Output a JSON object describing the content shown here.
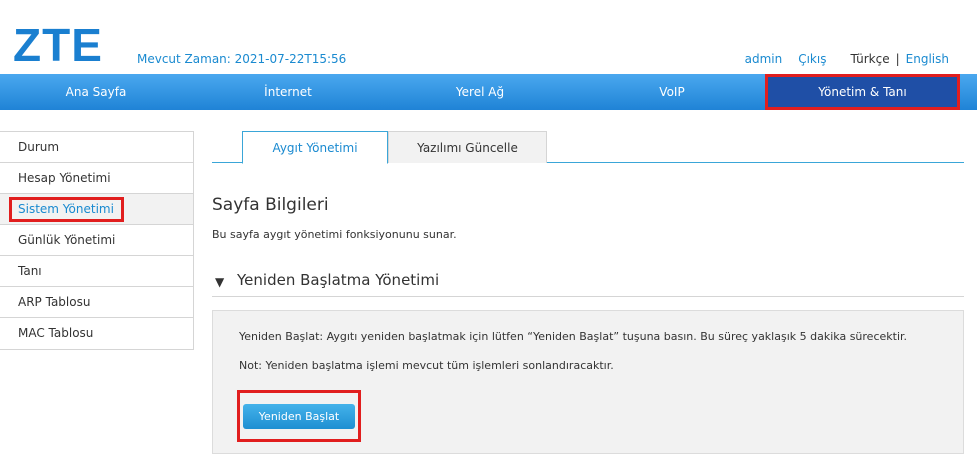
{
  "header": {
    "logo": "ZTE",
    "current_time": "Mevcut Zaman: 2021-07-22T15:56",
    "user": "admin",
    "logout": "Çıkış",
    "lang_current": "Türkçe",
    "lang_sep": "|",
    "lang_other": "English"
  },
  "nav": {
    "items": [
      {
        "label": "Ana Sayfa"
      },
      {
        "label": "İnternet"
      },
      {
        "label": "Yerel Ağ"
      },
      {
        "label": "VoIP"
      },
      {
        "label": "Yönetim & Tanı"
      }
    ],
    "active": "Yönetim & Tanı"
  },
  "sidebar": {
    "items": [
      {
        "label": "Durum"
      },
      {
        "label": "Hesap Yönetimi"
      },
      {
        "label": "Sistem Yönetimi"
      },
      {
        "label": "Günlük Yönetimi"
      },
      {
        "label": "Tanı"
      },
      {
        "label": "ARP Tablosu"
      },
      {
        "label": "MAC Tablosu"
      }
    ],
    "active": "Sistem Yönetimi"
  },
  "tabs": [
    {
      "label": "Aygıt Yönetimi"
    },
    {
      "label": "Yazılımı Güncelle"
    }
  ],
  "page": {
    "title": "Sayfa Bilgileri",
    "description": "Bu sayfa aygıt yönetimi fonksiyonunu sunar."
  },
  "section": {
    "title": "Yeniden Başlatma Yönetimi",
    "text1": "Yeniden Başlat: Aygıtı yeniden başlatmak için lütfen   “Yeniden Başlat”   tuşuna basın. Bu süreç yaklaşık 5 dakika sürecektir.",
    "text2": "Not: Yeniden başlatma işlemi mevcut tüm işlemleri sonlandıracaktır.",
    "button": "Yeniden  Başlat"
  },
  "colors": {
    "brand": "#1a7fd0",
    "nav_active": "#1f4fa6",
    "highlight": "#e11e1e"
  }
}
